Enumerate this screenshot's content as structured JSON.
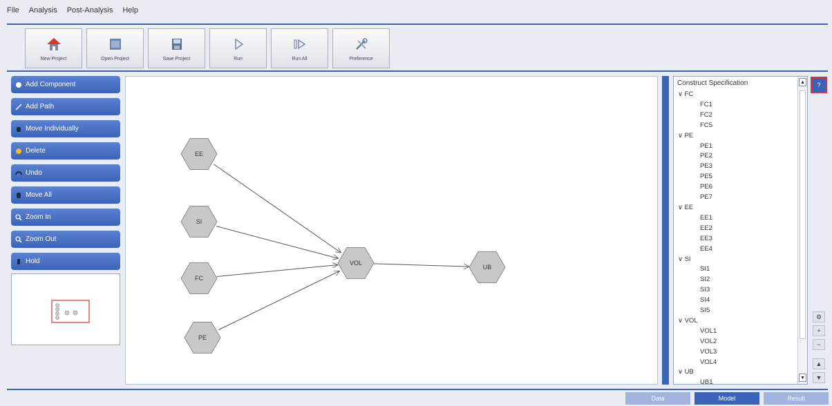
{
  "menu": [
    "File",
    "Analysis",
    "Post-Analysis",
    "Help"
  ],
  "toolbar": [
    {
      "label": "New Project",
      "icon": "home-icon"
    },
    {
      "label": "Open Project",
      "icon": "folder-icon"
    },
    {
      "label": "Save Project",
      "icon": "save-icon"
    },
    {
      "label": "Run",
      "icon": "play-icon"
    },
    {
      "label": "Run All",
      "icon": "play-all-icon"
    },
    {
      "label": "Preference",
      "icon": "tools-icon"
    }
  ],
  "left_buttons": [
    {
      "label": "Add Component",
      "icon": "circle-icon"
    },
    {
      "label": "Add Path",
      "icon": "path-icon"
    },
    {
      "label": "Move Individually",
      "icon": "hand-icon"
    },
    {
      "label": "Delete",
      "icon": "delete-icon"
    },
    {
      "label": "Undo",
      "icon": "undo-icon"
    },
    {
      "label": "Move All",
      "icon": "move-icon"
    },
    {
      "label": "Zoom In",
      "icon": "zoom-in-icon"
    },
    {
      "label": "Zoom Out",
      "icon": "zoom-out-icon"
    },
    {
      "label": "Hold",
      "icon": "hold-icon"
    }
  ],
  "diagram": {
    "nodes": [
      {
        "id": "EE",
        "label": "EE"
      },
      {
        "id": "SI",
        "label": "SI"
      },
      {
        "id": "FC",
        "label": "FC"
      },
      {
        "id": "PE",
        "label": "PE"
      },
      {
        "id": "VOL",
        "label": "VOL"
      },
      {
        "id": "UB",
        "label": "UB"
      }
    ],
    "edges": [
      [
        "EE",
        "VOL"
      ],
      [
        "SI",
        "VOL"
      ],
      [
        "FC",
        "VOL"
      ],
      [
        "PE",
        "VOL"
      ],
      [
        "VOL",
        "UB"
      ]
    ]
  },
  "tree": {
    "title": "Construct Specification",
    "groups": [
      {
        "name": "FC",
        "items": [
          "FC1",
          "FC2",
          "FC5"
        ]
      },
      {
        "name": "PE",
        "items": [
          "PE1",
          "PE2",
          "PE3",
          "PE5",
          "PE6",
          "PE7"
        ]
      },
      {
        "name": "EE",
        "items": [
          "EE1",
          "EE2",
          "EE3",
          "EE4"
        ]
      },
      {
        "name": "SI",
        "items": [
          "SI1",
          "SI2",
          "SI3",
          "SI4",
          "SI5"
        ]
      },
      {
        "name": "VOL",
        "items": [
          "VOL1",
          "VOL2",
          "VOL3",
          "VOL4"
        ]
      },
      {
        "name": "UB",
        "items": [
          "UB1"
        ]
      }
    ]
  },
  "help_label": "?",
  "side_controls": [
    "⚙",
    "+",
    "−",
    "▲",
    "▼"
  ],
  "bottom_tabs": [
    {
      "label": "Data",
      "active": false
    },
    {
      "label": "Model",
      "active": true
    },
    {
      "label": "Result",
      "active": false
    }
  ],
  "colors": {
    "accent": "#3a63b8",
    "node_fill": "#c8c8c8"
  }
}
